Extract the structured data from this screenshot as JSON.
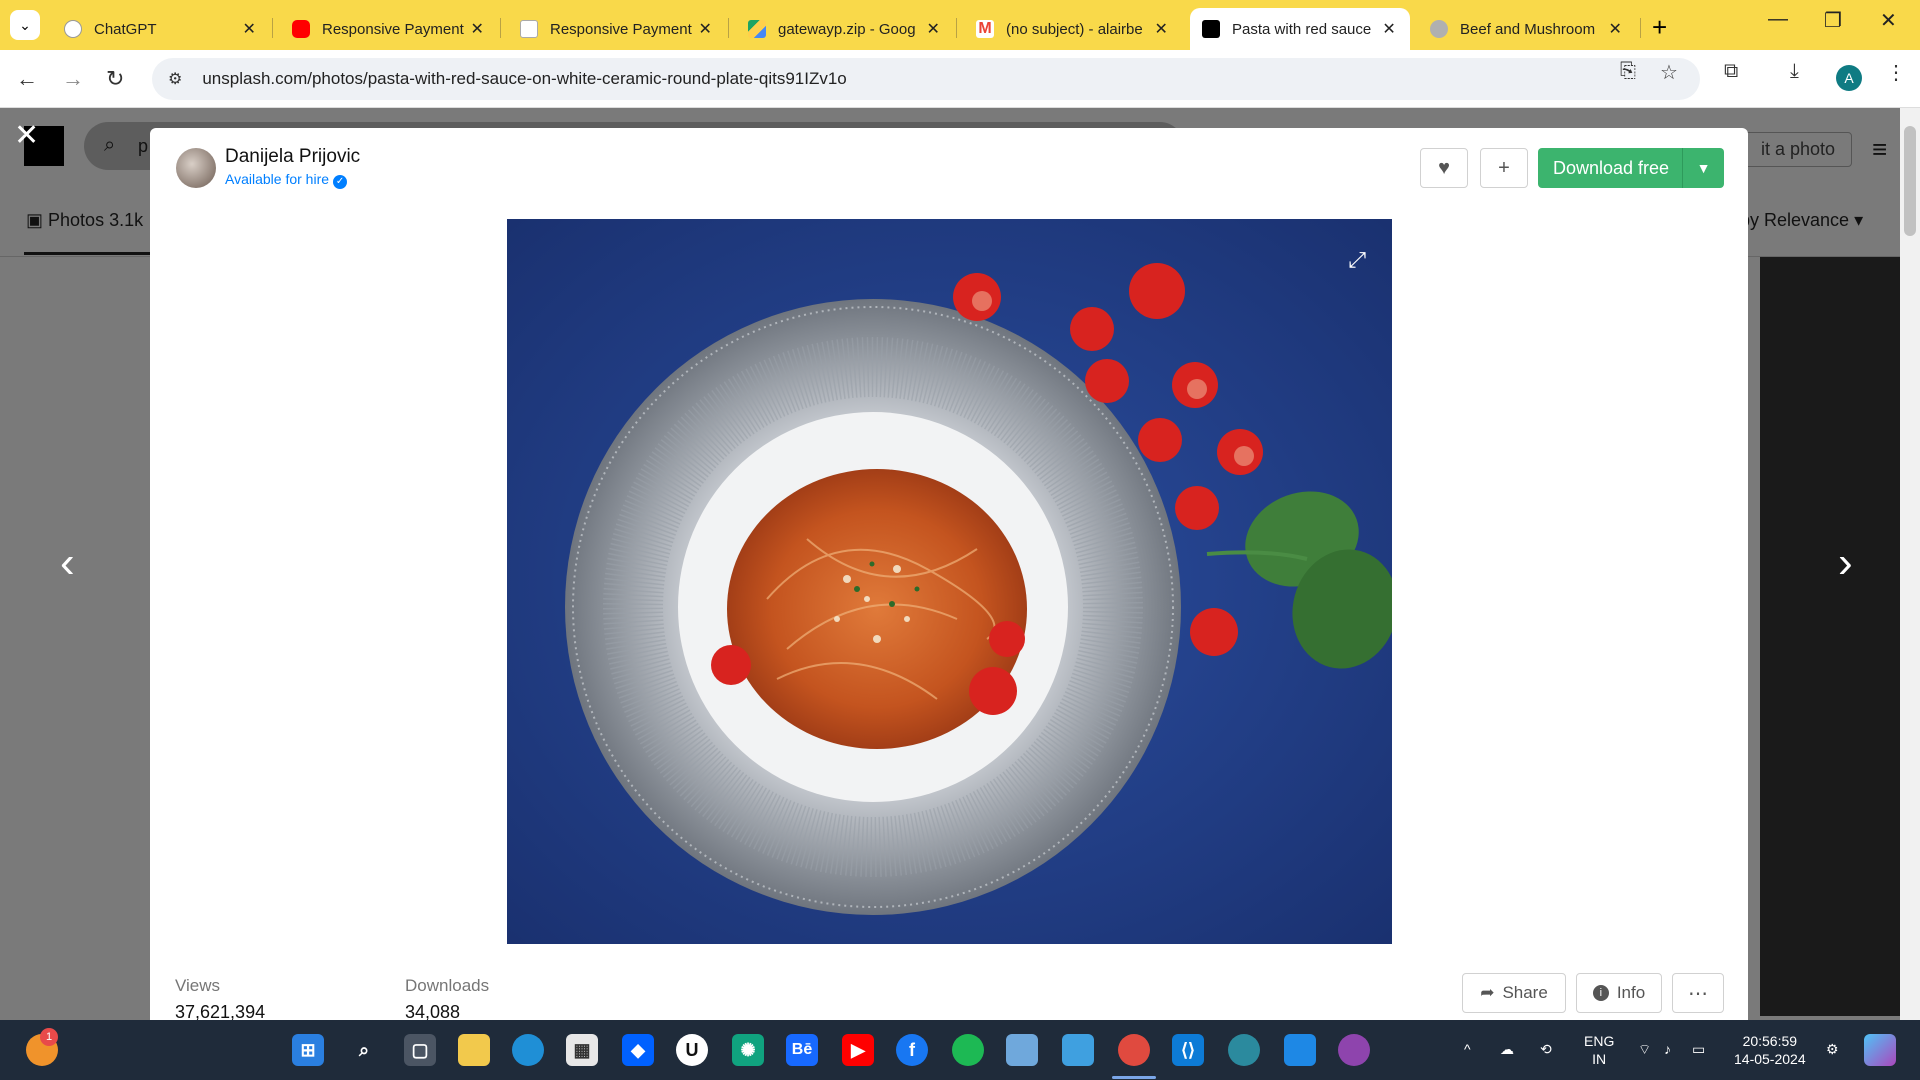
{
  "browser": {
    "tabs": [
      {
        "title": "ChatGPT",
        "fav_color": "#f1f1f1"
      },
      {
        "title": "Responsive Payment",
        "fav_color": "#ff0000"
      },
      {
        "title": "Responsive Payment",
        "fav_color": "#ffffff"
      },
      {
        "title": "gatewayp.zip - Goog",
        "fav_color": "#1fa463"
      },
      {
        "title": "(no subject) - alairbe",
        "fav_color": "#ea4335"
      },
      {
        "title": "Pasta with red sauce",
        "fav_color": "#000000"
      },
      {
        "title": "Beef and Mushroom",
        "fav_color": "#b0b0b0"
      }
    ],
    "url": "unsplash.com/photos/pasta-with-red-sauce-on-white-ceramic-round-plate-qits91IZv1o",
    "profile_initial": "A"
  },
  "underlay": {
    "search_prefix": "p",
    "photos_tab": "Photos 3.1k",
    "submit_partial": "it a photo",
    "sort_label": "by Relevance"
  },
  "modal": {
    "author_name": "Danijela Prijovic",
    "hire_label": "Available for hire",
    "download_label": "Download free",
    "views_label": "Views",
    "views_value": "37,621,394",
    "downloads_label": "Downloads",
    "downloads_value": "34,088",
    "share_label": "Share",
    "info_label": "Info"
  },
  "taskbar": {
    "lang_line1": "ENG",
    "lang_line2": "IN",
    "time": "20:56:59",
    "date": "14-05-2024",
    "notif_badge": "1"
  }
}
